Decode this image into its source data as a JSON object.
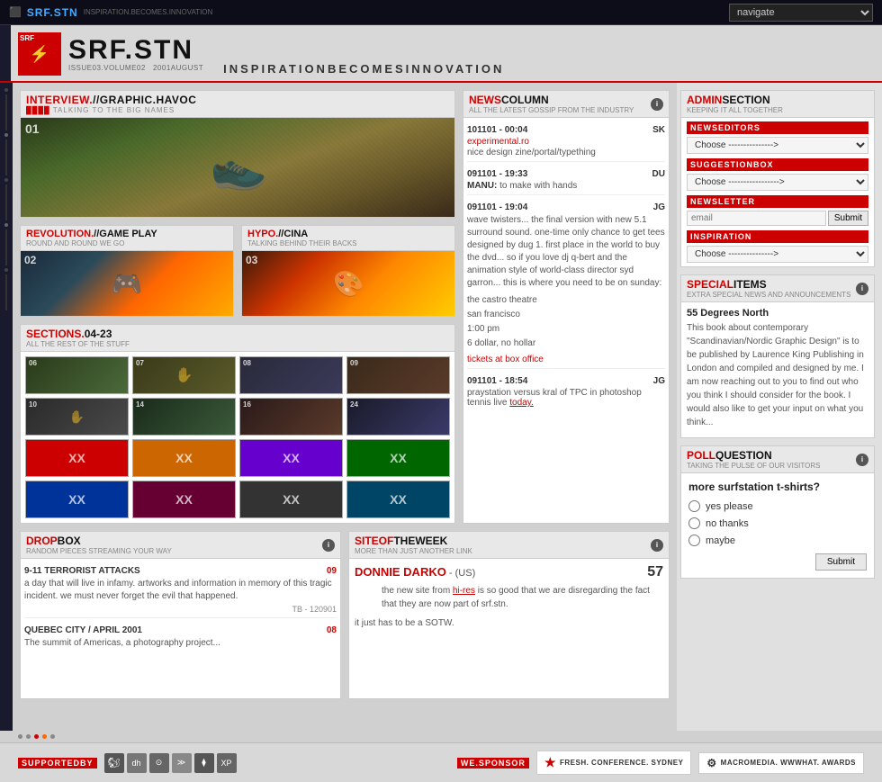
{
  "topbar": {
    "logo": "SRF.STN",
    "sub": "INSPIRATION.BECOMES.INNOVATION",
    "nav_placeholder": "navigate"
  },
  "header": {
    "brand": "SRF.STN",
    "issue": "ISSUE03.VOLUME02",
    "year": "2001AUGUST",
    "tagline": "INSPIRATIONBECOMESINNOVATION"
  },
  "interview": {
    "title": "INTERVIEW.//GRAPHIC.HAVOC",
    "subtitle": "TALKING TO THE BIG NAMES",
    "image_number": "01"
  },
  "news": {
    "title": "NEWSCOLUMN",
    "subtitle": "ALL THE LATEST GOSSIP FROM THE INDUSTRY",
    "items": [
      {
        "date": "101101 - 00:04",
        "author": "SK",
        "link": "experimental.ro",
        "link_text": "experimental.ro",
        "text": "nice design zine/portal/typething"
      },
      {
        "date": "091101 - 19:33",
        "author": "DU",
        "link_text": "MANU:",
        "text": "to make with hands"
      },
      {
        "date": "091101 - 19:04",
        "author": "JG",
        "text": "wave twisters... the final version with new 5.1 surround sound. one-time only chance to get tees designed by dug 1. first place in the world to buy the dvd... so if you love dj q-bert and the animation style of world-class director syd garron... this is where you need to be on sunday:",
        "event_lines": [
          "the castro theatre",
          "san francisco",
          "1:00 pm",
          "6 dollar, no hollar"
        ],
        "event_link": "tickets at box office"
      },
      {
        "date": "091101 - 18:54",
        "author": "JG",
        "text": "praystation versus kral of TPC in photoshop tennis live ",
        "link": "today."
      }
    ]
  },
  "gameplay": {
    "title": "REVOLUTION.//GAME PLAY",
    "subtitle": "ROUND AND ROUND WE GO",
    "image_number": "02"
  },
  "hypo": {
    "title": "HYPO.//CINA",
    "subtitle": "TALKING BEHIND THEIR BACKS",
    "image_number": "03"
  },
  "sections": {
    "title": "SECTIONS.04-23",
    "subtitle": "ALL THE REST OF THE STUFF",
    "thumbs": [
      {
        "num": "06",
        "cls": "th-06"
      },
      {
        "num": "07",
        "cls": "th-07"
      },
      {
        "num": "08",
        "cls": "th-08"
      },
      {
        "num": "09",
        "cls": "th-09"
      },
      {
        "num": "10",
        "cls": "th-10"
      },
      {
        "num": "14",
        "cls": "th-14"
      },
      {
        "num": "16",
        "cls": "th-16"
      },
      {
        "num": "24",
        "cls": "th-24"
      },
      {
        "num": "xx",
        "cls": "th-xx1"
      },
      {
        "num": "xx",
        "cls": "th-xx2"
      },
      {
        "num": "xx",
        "cls": "th-xx3"
      },
      {
        "num": "xx",
        "cls": "th-xx4"
      },
      {
        "num": "xx",
        "cls": "th-xx5"
      },
      {
        "num": "xx",
        "cls": "th-xx6"
      },
      {
        "num": "xx",
        "cls": "th-xx7"
      },
      {
        "num": "xx",
        "cls": "th-xx8"
      }
    ]
  },
  "dropbox": {
    "title": "DROPBOX",
    "subtitle": "RANDOM PIECES STREAMING YOUR WAY",
    "items": [
      {
        "title": "9-11 TERRORIST ATTACKS",
        "num": "09",
        "text": "a day that will live in infamy. artworks and information in memory of this tragic incident. we must never forget the evil that happened.",
        "author": "TB - 120901"
      },
      {
        "title": "QUEBEC CITY / APRIL 2001",
        "num": "08",
        "text": "The summit of Americas, a photography project..."
      }
    ]
  },
  "sotw": {
    "title": "SITEOFTHEWEEK",
    "subtitle": "MORE THAN JUST ANOTHER LINK",
    "link_text": "DONNIE DARKO",
    "origin": "- (US)",
    "count": "57",
    "desc_before": "the new site from ",
    "desc_link": "hi-res",
    "desc_after": " is so good that we are disregarding the fact that they are now part of srf.stn.",
    "footer": "it just has to be a SOTW."
  },
  "admin": {
    "title": "ADMINSECTION",
    "subtitle": "KEEPING IT ALL TOGETHER",
    "newseditors_title": "NEWSEDITORS",
    "newseditors_placeholder": "Choose --------------->",
    "suggestion_title": "SUGGESTIONBOX",
    "suggestion_placeholder": "Choose --------------->",
    "newsletter_title": "NEWSLETTER",
    "email_placeholder": "email",
    "submit_label": "Submit",
    "inspiration_title": "INSPIRATION",
    "inspiration_placeholder": "Choose --------------->"
  },
  "special": {
    "title": "SPECIALITEMS",
    "subtitle": "EXTRA SPECIAL NEWS AND ANNOUNCEMENTS",
    "item_title": "55 Degrees North",
    "item_text": "This book about contemporary \"Scandinavian/Nordic Graphic Design\" is to be published by Laurence King Publishing in London and compiled and designed by me. I am now reaching out to you to find out who you think I should consider for the book. I would also like to get your input on what you think..."
  },
  "poll": {
    "title": "POLLQUESTION",
    "subtitle": "TAKING THE PULSE OF OUR VISITORS",
    "question": "more surfstation t-shirts?",
    "options": [
      "yes please",
      "no thanks",
      "maybe"
    ],
    "submit_label": "Submit"
  },
  "footer": {
    "supported_by": "SUPPORTEDBY",
    "we_sponsor": "WE.SPONSOR",
    "conference": "FRESH. CONFERENCE. SYDNEY",
    "macromedia": "MACROMEDIA. WWWHAT. AWARDS"
  }
}
